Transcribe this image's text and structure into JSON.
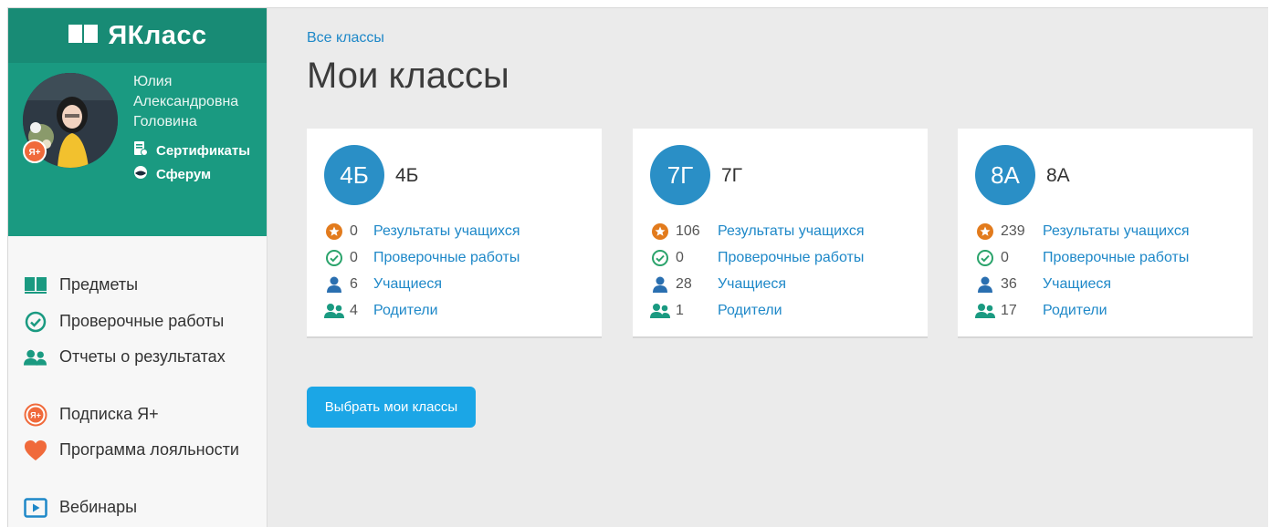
{
  "brand": {
    "name": "ЯКласс"
  },
  "user": {
    "name_lines": [
      "Юлия",
      "Александровна",
      "Головина"
    ],
    "links": [
      {
        "label": "Сертификаты",
        "icon": "certificate-icon"
      },
      {
        "label": "Сферум",
        "icon": "sferum-icon"
      }
    ]
  },
  "sidebar": {
    "items": [
      {
        "label": "Предметы",
        "icon": "book-icon"
      },
      {
        "label": "Проверочные работы",
        "icon": "check-circle-icon"
      },
      {
        "label": "Отчеты о результатах",
        "icon": "users-icon"
      },
      {
        "label": "Подписка Я+",
        "icon": "ya-plus-icon"
      },
      {
        "label": "Программа лояльности",
        "icon": "heart-icon"
      },
      {
        "label": "Вебинары",
        "icon": "play-icon"
      }
    ]
  },
  "page": {
    "breadcrumb": "Все классы",
    "title": "Мои классы"
  },
  "classes": [
    {
      "badge": "4Б",
      "name": "4Б",
      "stats": [
        {
          "value": "0",
          "label": "Результаты учащихся"
        },
        {
          "value": "0",
          "label": "Проверочные работы"
        },
        {
          "value": "6",
          "label": "Учащиеся"
        },
        {
          "value": "4",
          "label": "Родители"
        }
      ]
    },
    {
      "badge": "7Г",
      "name": "7Г",
      "stats": [
        {
          "value": "106",
          "label": "Результаты учащихся"
        },
        {
          "value": "0",
          "label": "Проверочные работы"
        },
        {
          "value": "28",
          "label": "Учащиеся"
        },
        {
          "value": "1",
          "label": "Родители"
        }
      ]
    },
    {
      "badge": "8А",
      "name": "8А",
      "stats": [
        {
          "value": "239",
          "label": "Результаты учащихся"
        },
        {
          "value": "0",
          "label": "Проверочные работы"
        },
        {
          "value": "36",
          "label": "Учащиеся"
        },
        {
          "value": "17",
          "label": "Родители"
        }
      ]
    }
  ],
  "actions": {
    "choose_classes": "Выбрать мои классы"
  },
  "colors": {
    "brand_dark": "#188b75",
    "brand": "#1a9a81",
    "accent_blue": "#2a8fc6",
    "link": "#1e88c8",
    "button": "#1ba6e6",
    "star_orange": "#e27b1d",
    "check_green": "#2aa36b"
  }
}
